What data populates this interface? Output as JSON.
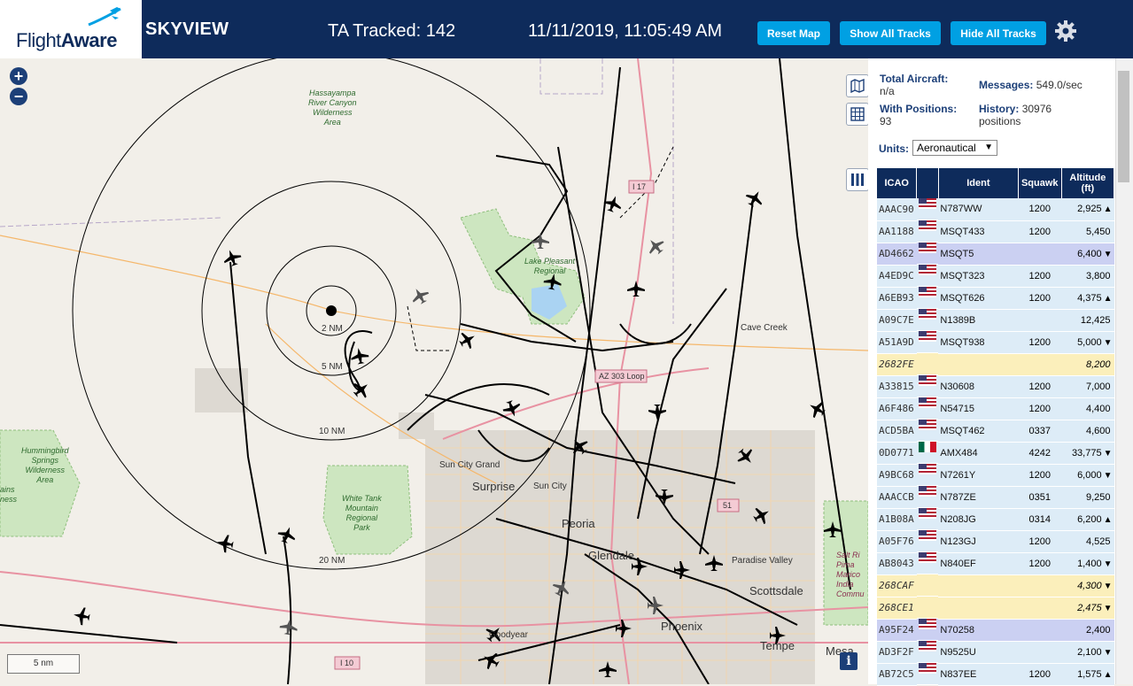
{
  "header": {
    "logo_text_a": "Flight",
    "logo_text_b": "Aware",
    "app_title": "SKYVIEW",
    "tracked": "TA Tracked: 142",
    "datetime": "11/11/2019, 11:05:49 AM",
    "reset_map": "Reset Map",
    "show_all": "Show All Tracks",
    "hide_all": "Hide All Tracks"
  },
  "stats": {
    "total_label": "Total Aircraft:",
    "total_value": "n/a",
    "positions_label": "With Positions:",
    "positions_value": "93",
    "messages_label": "Messages:",
    "messages_value": "549.0/sec",
    "history_label": "History:",
    "history_value": "30976",
    "history_unit": "positions",
    "units_label": "Units:",
    "units_value": "Aeronautical"
  },
  "table": {
    "headers": [
      "ICAO",
      "",
      "Ident",
      "Squawk",
      "Altitude (ft)"
    ],
    "rows": [
      {
        "icao": "AAAC90",
        "flag": "us",
        "ident": "N787WW",
        "squawk": "1200",
        "alt": "2,925",
        "trend": "▲",
        "style": "rb"
      },
      {
        "icao": "AA1188",
        "flag": "us",
        "ident": "MSQT433",
        "squawk": "1200",
        "alt": "5,450",
        "trend": "",
        "style": "rb"
      },
      {
        "icao": "AD4662",
        "flag": "us",
        "ident": "MSQT5",
        "squawk": "",
        "alt": "6,400",
        "trend": "▼",
        "style": "rs"
      },
      {
        "icao": "A4ED9C",
        "flag": "us",
        "ident": "MSQT323",
        "squawk": "1200",
        "alt": "3,800",
        "trend": "",
        "style": "rb"
      },
      {
        "icao": "A6EB93",
        "flag": "us",
        "ident": "MSQT626",
        "squawk": "1200",
        "alt": "4,375",
        "trend": "▲",
        "style": "rb"
      },
      {
        "icao": "A09C7E",
        "flag": "us",
        "ident": "N1389B",
        "squawk": "",
        "alt": "12,425",
        "trend": "",
        "style": "rb"
      },
      {
        "icao": "A51A9D",
        "flag": "us",
        "ident": "MSQT938",
        "squawk": "1200",
        "alt": "5,000",
        "trend": "▼",
        "style": "rb"
      },
      {
        "icao": "2682FE",
        "flag": "",
        "ident": "",
        "squawk": "",
        "alt": "8,200",
        "trend": "",
        "style": "ry"
      },
      {
        "icao": "A33815",
        "flag": "us",
        "ident": "N30608",
        "squawk": "1200",
        "alt": "7,000",
        "trend": "",
        "style": "rb"
      },
      {
        "icao": "A6F486",
        "flag": "us",
        "ident": "N54715",
        "squawk": "1200",
        "alt": "4,400",
        "trend": "",
        "style": "rb"
      },
      {
        "icao": "ACD5BA",
        "flag": "us",
        "ident": "MSQT462",
        "squawk": "0337",
        "alt": "4,600",
        "trend": "",
        "style": "rb"
      },
      {
        "icao": "0D0771",
        "flag": "mx",
        "ident": "AMX484",
        "squawk": "4242",
        "alt": "33,775",
        "trend": "▼",
        "style": "rb"
      },
      {
        "icao": "A9BC68",
        "flag": "us",
        "ident": "N7261Y",
        "squawk": "1200",
        "alt": "6,000",
        "trend": "▼",
        "style": "rb"
      },
      {
        "icao": "AAACCB",
        "flag": "us",
        "ident": "N787ZE",
        "squawk": "0351",
        "alt": "9,250",
        "trend": "",
        "style": "rb"
      },
      {
        "icao": "A1B08A",
        "flag": "us",
        "ident": "N208JG",
        "squawk": "0314",
        "alt": "6,200",
        "trend": "▲",
        "style": "rb"
      },
      {
        "icao": "A05F76",
        "flag": "us",
        "ident": "N123GJ",
        "squawk": "1200",
        "alt": "4,525",
        "trend": "",
        "style": "rb"
      },
      {
        "icao": "AB8043",
        "flag": "us",
        "ident": "N840EF",
        "squawk": "1200",
        "alt": "1,400",
        "trend": "▼",
        "style": "rb"
      },
      {
        "icao": "268CAF",
        "flag": "",
        "ident": "",
        "squawk": "",
        "alt": "4,300",
        "trend": "▼",
        "style": "ry"
      },
      {
        "icao": "268CE1",
        "flag": "",
        "ident": "",
        "squawk": "",
        "alt": "2,475",
        "trend": "▼",
        "style": "ry"
      },
      {
        "icao": "A95F24",
        "flag": "us",
        "ident": "N70258",
        "squawk": "",
        "alt": "2,400",
        "trend": "",
        "style": "rs"
      },
      {
        "icao": "AD3F2F",
        "flag": "us",
        "ident": "N9525U",
        "squawk": "",
        "alt": "2,100",
        "trend": "▼",
        "style": "rb"
      },
      {
        "icao": "AB72C5",
        "flag": "us",
        "ident": "N837EE",
        "squawk": "1200",
        "alt": "1,575",
        "trend": "▲",
        "style": "rb"
      }
    ]
  },
  "map": {
    "range_labels": [
      "2 NM",
      "5 NM",
      "10 NM",
      "20 NM"
    ],
    "scale": "5 nm",
    "places": [
      {
        "name": "Sun City Grand",
        "cls": "sm"
      },
      {
        "name": "Surprise",
        "cls": "lg"
      },
      {
        "name": "Sun City",
        "cls": "sm"
      },
      {
        "name": "Peoria",
        "cls": "lg"
      },
      {
        "name": "Glendale",
        "cls": "lg"
      },
      {
        "name": "Paradise Valley",
        "cls": "sm"
      },
      {
        "name": "Scottsdale",
        "cls": "lg"
      },
      {
        "name": "Phoenix",
        "cls": "lg"
      },
      {
        "name": "Cave Creek",
        "cls": "sm"
      },
      {
        "name": "Goodyear",
        "cls": "sm"
      },
      {
        "name": "Tempe",
        "cls": "lg"
      },
      {
        "name": "Mesa",
        "cls": "lg"
      }
    ],
    "parks": [
      "Hassayampa\nRiver Canyon\nWilderness\nArea",
      "Lake Pleasant\nRegional",
      "White Tank\nMountain\nRegional\nPark",
      "Hummingbird\nSprings\nWilderness\nArea",
      "ains\nness",
      "Salt Ri\nPima\nMarico\nIndia\nCommu"
    ],
    "shields": [
      "I 17",
      "AZ 303 Loop",
      "51",
      "I 10"
    ]
  },
  "colors": {
    "navy": "#0e2b5b",
    "accent": "#00a0e3"
  }
}
